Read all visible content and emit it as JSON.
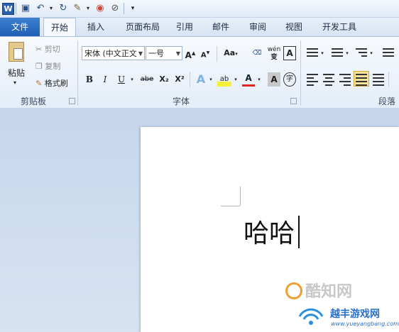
{
  "qat": {
    "app_icon": "W",
    "icons": [
      "save-icon",
      "undo-icon",
      "redo-icon",
      "format-painter-icon",
      "color-wheel-icon",
      "clear-icon",
      "customize-icon"
    ]
  },
  "tabs": [
    {
      "label": "文件"
    },
    {
      "label": "开始"
    },
    {
      "label": "插入"
    },
    {
      "label": "页面布局"
    },
    {
      "label": "引用"
    },
    {
      "label": "邮件"
    },
    {
      "label": "审阅"
    },
    {
      "label": "视图"
    },
    {
      "label": "开发工具"
    }
  ],
  "clipboard": {
    "paste": "粘贴",
    "cut": "剪切",
    "copy": "复制",
    "format_painter": "格式刷",
    "group": "剪贴板"
  },
  "font": {
    "name": "宋体 (中文正文",
    "size": "一号",
    "grow": "A",
    "shrink": "A",
    "case": "Aa",
    "phonetic": "wén",
    "char_border": "A",
    "bold": "B",
    "italic": "I",
    "underline": "U",
    "strike": "abe",
    "sub": "X₂",
    "sup": "X²",
    "effect": "A",
    "highlight": "ab",
    "color": "A",
    "shading": "A",
    "enclose": "字",
    "group": "字体"
  },
  "paragraph": {
    "group": "段落"
  },
  "document": {
    "text": "哈哈"
  },
  "watermark": {
    "brand1": "酷知网",
    "brand2": "越丰游戏网",
    "url": "www.yueyangbang.com"
  }
}
